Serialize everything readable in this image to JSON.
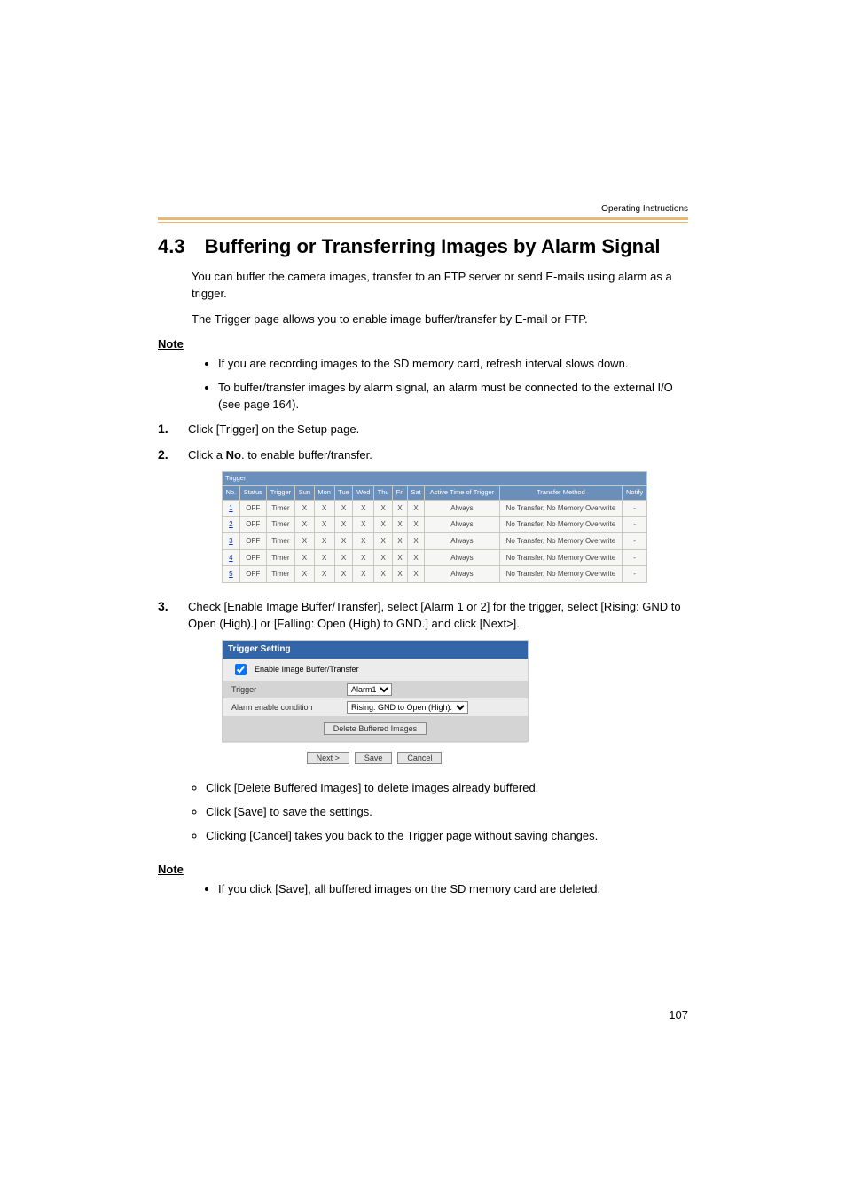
{
  "running_head": "Operating Instructions",
  "section_num": "4.3",
  "section_title": "Buffering or Transferring Images by Alarm Signal",
  "intro_p1": "You can buffer the camera images, transfer to an FTP server or send E-mails using alarm as a trigger.",
  "intro_p2": "The Trigger page allows you to enable image buffer/transfer by E-mail or FTP.",
  "note_label": "Note",
  "note1_b1": "If you are recording images to the SD memory card, refresh interval slows down.",
  "note1_b2": "To buffer/transfer images by alarm signal, an alarm must be connected to the external I/O (see page 164).",
  "step1_num": "1.",
  "step1_text": "Click [Trigger] on the Setup page.",
  "step2_num": "2.",
  "step2_text_pre": "Click a ",
  "step2_text_bold": "No",
  "step2_text_post": ". to enable buffer/transfer.",
  "trigger_table": {
    "title": "Trigger",
    "headers": [
      "No.",
      "Status",
      "Trigger",
      "Sun",
      "Mon",
      "Tue",
      "Wed",
      "Thu",
      "Fri",
      "Sat",
      "Active Time of Trigger",
      "Transfer Method",
      "Notify"
    ],
    "rows": [
      {
        "no": "1",
        "status": "OFF",
        "trigger": "Timer",
        "sun": "X",
        "mon": "X",
        "tue": "X",
        "wed": "X",
        "thu": "X",
        "fri": "X",
        "sat": "X",
        "active": "Always",
        "method": "No Transfer, No Memory Overwrite",
        "notify": "-"
      },
      {
        "no": "2",
        "status": "OFF",
        "trigger": "Timer",
        "sun": "X",
        "mon": "X",
        "tue": "X",
        "wed": "X",
        "thu": "X",
        "fri": "X",
        "sat": "X",
        "active": "Always",
        "method": "No Transfer, No Memory Overwrite",
        "notify": "-"
      },
      {
        "no": "3",
        "status": "OFF",
        "trigger": "Timer",
        "sun": "X",
        "mon": "X",
        "tue": "X",
        "wed": "X",
        "thu": "X",
        "fri": "X",
        "sat": "X",
        "active": "Always",
        "method": "No Transfer, No Memory Overwrite",
        "notify": "-"
      },
      {
        "no": "4",
        "status": "OFF",
        "trigger": "Timer",
        "sun": "X",
        "mon": "X",
        "tue": "X",
        "wed": "X",
        "thu": "X",
        "fri": "X",
        "sat": "X",
        "active": "Always",
        "method": "No Transfer, No Memory Overwrite",
        "notify": "-"
      },
      {
        "no": "5",
        "status": "OFF",
        "trigger": "Timer",
        "sun": "X",
        "mon": "X",
        "tue": "X",
        "wed": "X",
        "thu": "X",
        "fri": "X",
        "sat": "X",
        "active": "Always",
        "method": "No Transfer, No Memory Overwrite",
        "notify": "-"
      }
    ]
  },
  "step3_num": "3.",
  "step3_text": "Check [Enable Image Buffer/Transfer], select [Alarm 1 or 2] for the trigger, select [Rising: GND to Open (High).] or [Falling: Open (High) to GND.] and click [Next>].",
  "setting_panel": {
    "title": "Trigger Setting",
    "enable_label": "Enable Image Buffer/Transfer",
    "row_trigger_label": "Trigger",
    "row_trigger_value": "Alarm1",
    "row_cond_label": "Alarm enable condition",
    "row_cond_value": "Rising: GND to Open (High).",
    "delete_btn": "Delete Buffered Images",
    "next_btn": "Next >",
    "save_btn": "Save",
    "cancel_btn": "Cancel"
  },
  "after_bullets": {
    "b1": "Click [Delete Buffered Images] to delete images already buffered.",
    "b2": "Click [Save] to save the settings.",
    "b3": "Clicking [Cancel] takes you back to the Trigger page without saving changes."
  },
  "note2_b1": "If you click [Save], all buffered images on the SD memory card are deleted.",
  "page_num": "107"
}
